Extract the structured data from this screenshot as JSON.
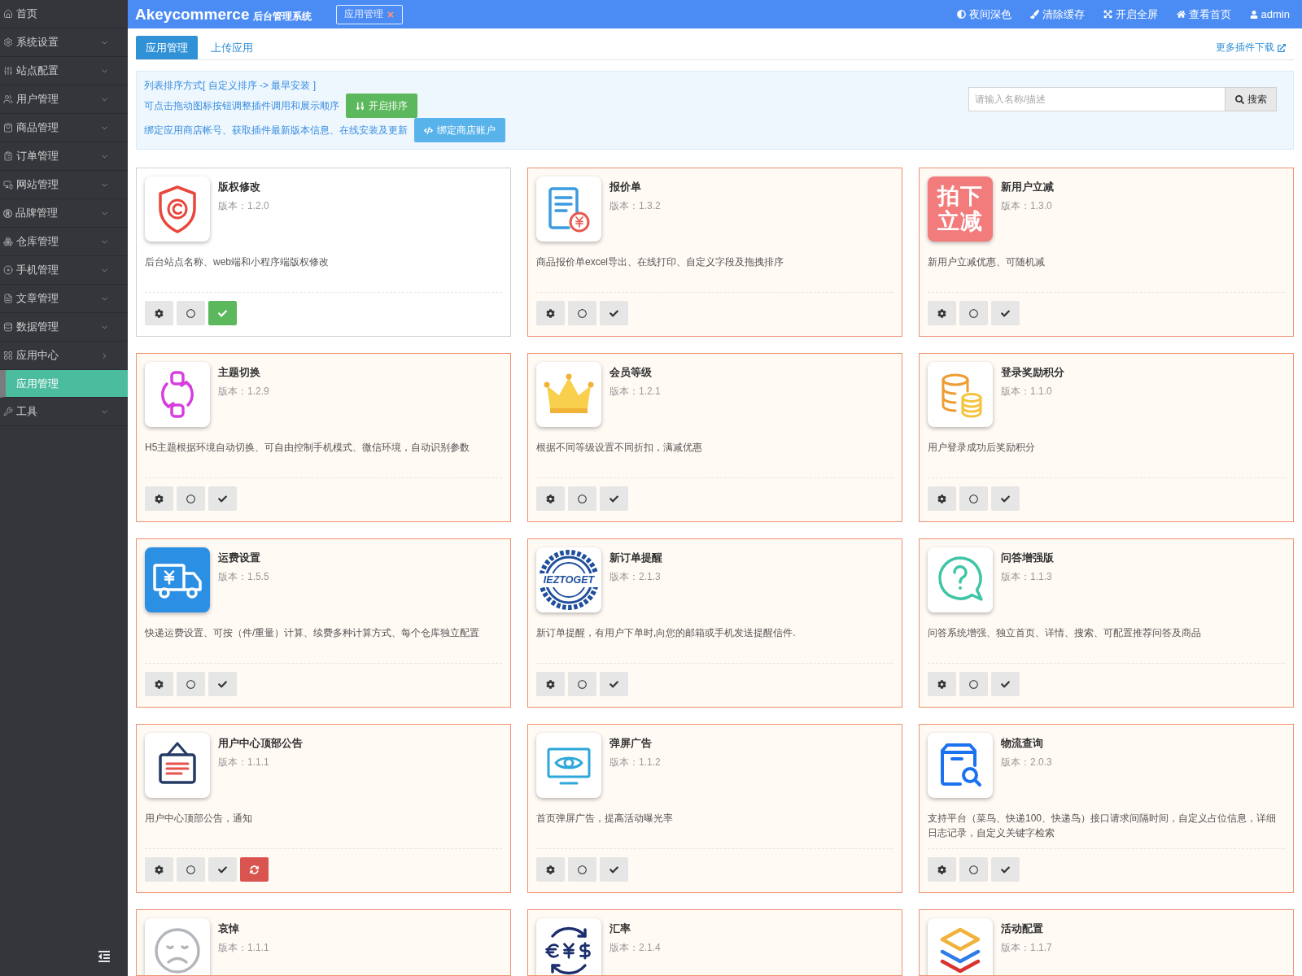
{
  "sidebar": {
    "items": [
      {
        "label": "首页",
        "kind": "link",
        "selected": false
      },
      {
        "label": "系统设置",
        "kind": "menu",
        "expanded": false,
        "selected": false
      },
      {
        "label": "站点配置",
        "kind": "menu",
        "expanded": false,
        "selected": false
      },
      {
        "label": "用户管理",
        "kind": "menu",
        "expanded": false,
        "selected": false
      },
      {
        "label": "商品管理",
        "kind": "menu",
        "expanded": false,
        "selected": false
      },
      {
        "label": "订单管理",
        "kind": "menu",
        "expanded": false,
        "selected": false
      },
      {
        "label": "网站管理",
        "kind": "menu",
        "expanded": false,
        "selected": false
      },
      {
        "label": "品牌管理",
        "kind": "menu",
        "expanded": false,
        "selected": false
      },
      {
        "label": "仓库管理",
        "kind": "menu",
        "expanded": false,
        "selected": false
      },
      {
        "label": "手机管理",
        "kind": "menu",
        "expanded": false,
        "selected": false
      },
      {
        "label": "文章管理",
        "kind": "menu",
        "expanded": false,
        "selected": false
      },
      {
        "label": "数据管理",
        "kind": "menu",
        "expanded": false,
        "selected": false
      },
      {
        "label": "应用中心",
        "kind": "menu",
        "expanded": true,
        "selected": false,
        "children": [
          {
            "label": "应用管理",
            "selected": true
          }
        ]
      },
      {
        "label": "工具",
        "kind": "menu",
        "expanded": false,
        "selected": false
      }
    ]
  },
  "header": {
    "brand": "Akeycommerce",
    "subtitle": "后台管理系统",
    "open_tabs": [
      {
        "label": "应用管理"
      }
    ],
    "actions": [
      "夜间深色",
      "清除缓存",
      "开启全屏",
      "查看首页"
    ],
    "user": "admin"
  },
  "tabs": [
    {
      "label": "应用管理",
      "selected": true
    },
    {
      "label": "上传应用",
      "selected": false
    }
  ],
  "more_link": "更多插件下载",
  "notice": {
    "sort_note": "列表排序方式[ 自定义排序 -> 最早安装 ]",
    "drag_note": "可点击拖动图标按钮调整插件调用和展示顺序",
    "sort_button": "开启排序",
    "bind_note": "绑定应用商店帐号、获取插件最新版本信息、在线安装及更新",
    "bind_button": "绑定商店账户"
  },
  "search": {
    "placeholder": "请输入名称/描述",
    "button": "搜索"
  },
  "apps": [
    {
      "title": "版权修改",
      "version": "版本：1.2.0",
      "description": "后台站点名称、web端和小程序端版权修改",
      "enabled": true,
      "update_available": false
    },
    {
      "title": "报价单",
      "version": "版本：1.3.2",
      "description": "商品报价单excel导出、在线打印、自定义字段及拖拽排序",
      "enabled": false,
      "update_available": false
    },
    {
      "title": "新用户立减",
      "version": "版本：1.3.0",
      "description": "新用户立减优惠、可随机减",
      "enabled": false,
      "update_available": false,
      "logo_text": [
        "拍下",
        "立减"
      ]
    },
    {
      "title": "主题切换",
      "version": "版本：1.2.9",
      "description": "H5主题根据环境自动切换、可自由控制手机模式、微信环境，自动识别参数",
      "enabled": false,
      "update_available": false
    },
    {
      "title": "会员等级",
      "version": "版本：1.2.1",
      "description": "根据不同等级设置不同折扣，满减优惠",
      "enabled": false,
      "update_available": false
    },
    {
      "title": "登录奖励积分",
      "version": "版本：1.1.0",
      "description": "用户登录成功后奖励积分",
      "enabled": false,
      "update_available": false
    },
    {
      "title": "运费设置",
      "version": "版本：1.5.5",
      "description": "快递运费设置、可按（件/重量）计算、续费多种计算方式、每个仓库独立配置",
      "enabled": false,
      "update_available": false
    },
    {
      "title": "新订单提醒",
      "version": "版本：2.1.3",
      "description": "新订单提醒，有用户下单时,向您的邮箱或手机发送提醒信件.",
      "enabled": false,
      "update_available": false,
      "logo_text": [
        "IEZTOGET"
      ]
    },
    {
      "title": "问答增强版",
      "version": "版本：1.1.3",
      "description": "问答系统增强、独立首页、详情、搜索、可配置推荐问答及商品",
      "enabled": false,
      "update_available": false
    },
    {
      "title": "用户中心顶部公告",
      "version": "版本：1.1.1",
      "description": "用户中心顶部公告，通知",
      "enabled": false,
      "update_available": true
    },
    {
      "title": "弹屏广告",
      "version": "版本：1.1.2",
      "description": "首页弹屏广告，提高活动曝光率",
      "enabled": false,
      "update_available": false
    },
    {
      "title": "物流查询",
      "version": "版本：2.0.3",
      "description": "支持平台（菜鸟、快递100、快递鸟）接口请求间隔时间，自定义占位信息，详细日志记录，自定义关键字检索",
      "enabled": false,
      "update_available": false
    },
    {
      "title": "哀悼",
      "version": "版本：1.1.1",
      "enabled": false
    },
    {
      "title": "汇率",
      "version": "版本：2.1.4",
      "enabled": false
    },
    {
      "title": "活动配置",
      "version": "版本：1.1.7",
      "enabled": false
    }
  ]
}
